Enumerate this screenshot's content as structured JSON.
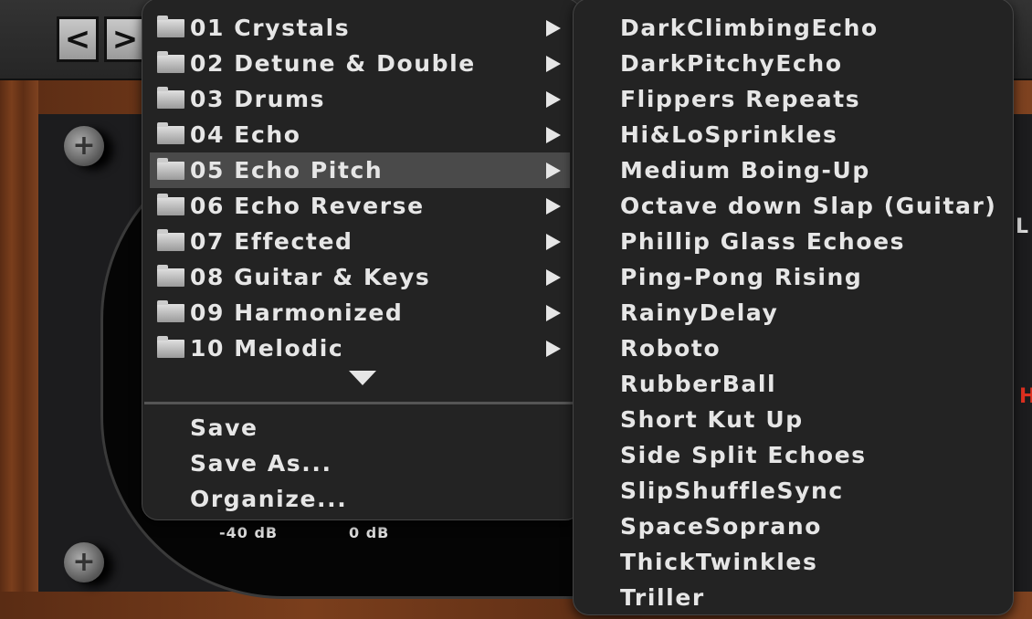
{
  "toolbar": {
    "back_icon": "chevron-left",
    "forward_icon": "chevron-right",
    "back_glyph": "<",
    "forward_glyph": ">"
  },
  "meter": {
    "min_label": "-40 dB",
    "max_label": "0 dB"
  },
  "side_labels": {
    "top": "L",
    "red": "H"
  },
  "colors": {
    "menu_bg": "#232323",
    "highlight": "#4a4a4a",
    "text": "#e6e6e6",
    "red_label": "#e03020"
  },
  "preset_menu": {
    "folders": [
      {
        "label": "01 Crystals"
      },
      {
        "label": "02 Detune & Double"
      },
      {
        "label": "03 Drums"
      },
      {
        "label": "04 Echo"
      },
      {
        "label": "05 Echo Pitch",
        "highlighted": true
      },
      {
        "label": "06 Echo Reverse"
      },
      {
        "label": "07 Effected"
      },
      {
        "label": "08 Guitar & Keys"
      },
      {
        "label": "09 Harmonized"
      },
      {
        "label": "10 Melodic"
      }
    ],
    "actions": [
      "Save",
      "Save As...",
      "Organize..."
    ]
  },
  "submenu": {
    "items": [
      "DarkClimbingEcho",
      "DarkPitchyEcho",
      "Flippers Repeats",
      "Hi&LoSprinkles",
      "Medium Boing-Up",
      "Octave down Slap (Guitar)",
      "Phillip Glass Echoes",
      "Ping-Pong Rising",
      "RainyDelay",
      "Roboto",
      "RubberBall",
      "Short Kut Up",
      "Side Split Echoes",
      "SlipShuffleSync",
      "SpaceSoprano",
      "ThickTwinkles",
      "Triller"
    ]
  }
}
